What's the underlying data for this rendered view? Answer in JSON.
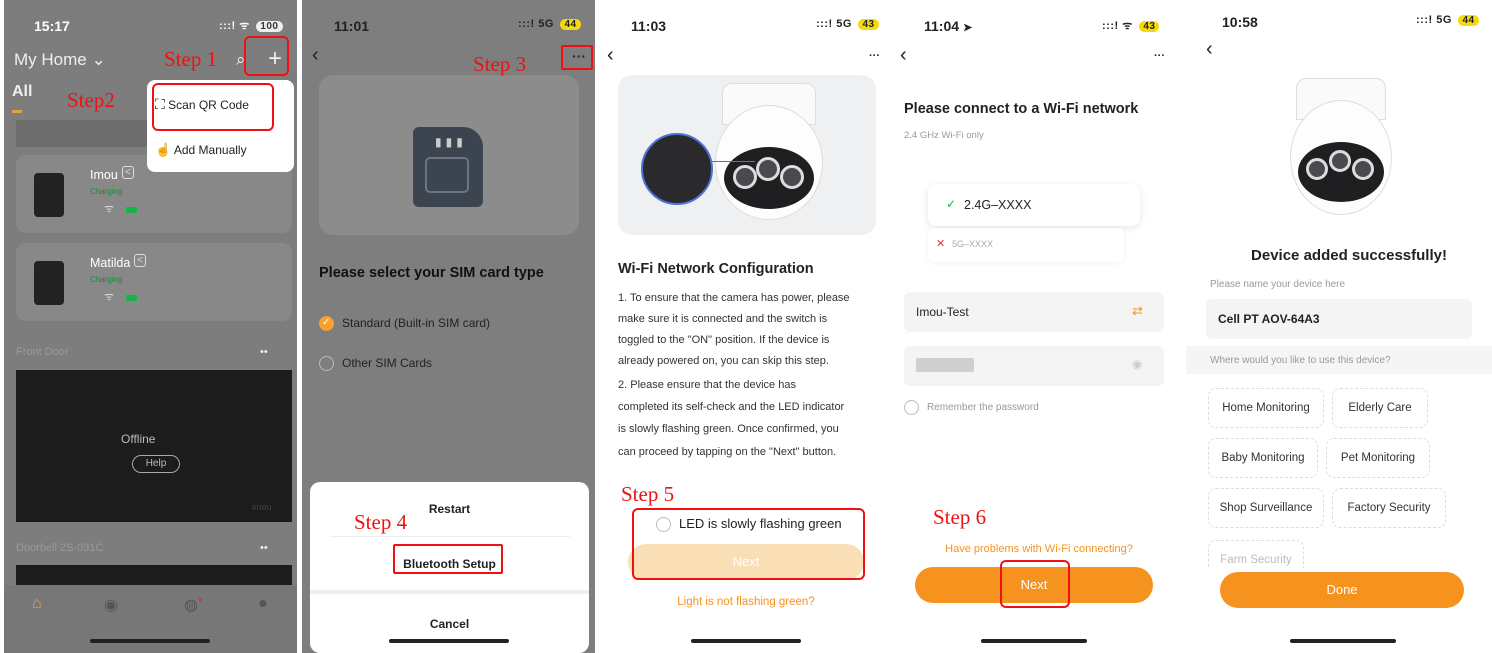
{
  "steps": {
    "s1": "Step 1",
    "s2": "Step2",
    "s3": "Step 3",
    "s4": "Step 4",
    "s5": "Step 5",
    "s6": "Step 6"
  },
  "screen1": {
    "time": "15:17",
    "battery": "100",
    "home_title": "My Home",
    "tab_all": "All",
    "menu": {
      "scan": "Scan QR Code",
      "manual": "Add Manually"
    },
    "devices": [
      {
        "name": "Imou",
        "status": "Charging"
      },
      {
        "name": "Matilda",
        "status": "Charging"
      }
    ],
    "front_door": "Front Door",
    "offline": "Offline",
    "help": "Help",
    "watermark": "imou",
    "doorbell": "Doorbell 2S-031C",
    "more": "••"
  },
  "screen2": {
    "time": "11:01",
    "network": "5G",
    "battery": "44",
    "title": "Please select your SIM card type",
    "options": [
      "Standard (Built-in SIM card)",
      "Other SIM Cards"
    ],
    "sheet": {
      "restart": "Restart",
      "bluetooth": "Bluetooth Setup",
      "cancel": "Cancel"
    }
  },
  "screen3": {
    "time": "11:03",
    "network": "5G",
    "battery": "43",
    "title": "Wi-Fi Network Configuration",
    "lines": [
      "1. To ensure that the camera has power, please",
      "make sure it is connected and the switch is",
      "toggled to the \"ON\" position. If the device is",
      "already powered on, you can skip this step.",
      "2. Please ensure that the device has",
      "completed its self-check and the LED indicator",
      "is slowly flashing green. Once confirmed, you",
      "can proceed by tapping on the \"Next\" button."
    ],
    "led_check": "LED is slowly flashing green",
    "next": "Next",
    "help_link": "Light is not flashing green?"
  },
  "screen4": {
    "time": "11:04",
    "battery": "43",
    "title": "Please connect to a Wi-Fi network",
    "subtitle": "2.4 GHz Wi-Fi only",
    "ok_net": "2.4G–XXXX",
    "bad_net": "5G–XXXX",
    "ssid": "Imou-Test",
    "remember": "Remember the password",
    "problem_link": "Have problems with Wi-Fi connecting?",
    "next": "Next"
  },
  "screen5": {
    "time": "10:58",
    "network": "5G",
    "battery": "44",
    "title": "Device added successfully!",
    "name_label": "Please name your device here",
    "name_value": "Cell PT AOV-64A3",
    "use_label": "Where would you like to use this device?",
    "chips": [
      "Home Monitoring",
      "Elderly Care",
      "Baby Monitoring",
      "Pet Monitoring",
      "Shop Surveillance",
      "Factory Security",
      "Farm Security"
    ],
    "done": "Done"
  }
}
